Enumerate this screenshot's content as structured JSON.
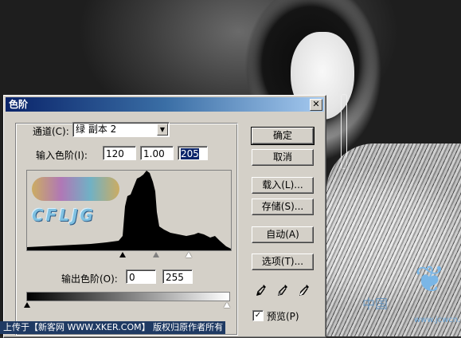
{
  "dialog": {
    "title": "色阶",
    "close_glyph": "✕",
    "channel_label": "通道(C):",
    "channel_value": "绿 副本 2",
    "input_label": "输入色阶(I):",
    "input_values": [
      "120",
      "1.00",
      "205"
    ],
    "output_label": "输出色阶(O):",
    "output_values": [
      "0",
      "255"
    ],
    "buttons": {
      "ok": "确定",
      "cancel": "取消",
      "load": "载入(L)...",
      "save": "存储(S)...",
      "auto": "自动(A)",
      "options": "选项(T)..."
    },
    "preview_label": "预览(P)",
    "preview_checked": "✓",
    "eyedropper_icons": [
      "black-eyedropper-icon",
      "gray-eyedropper-icon",
      "white-eyedropper-icon"
    ],
    "histogram_watermark": "CFLJG"
  },
  "watermark": {
    "site_short": "www.jcwcn.com",
    "wing_glyph": "❦",
    "cn": "中国"
  },
  "footer": {
    "text": "上传于【新客网 WWW.XKER.COM】 版权归原作者所有"
  },
  "colors": {
    "dialog_bg": "#d4d0c8",
    "title_start": "#0a246a",
    "title_end": "#a6caf0",
    "selection": "#0a246a",
    "footer_bg": "#1f3a63"
  }
}
